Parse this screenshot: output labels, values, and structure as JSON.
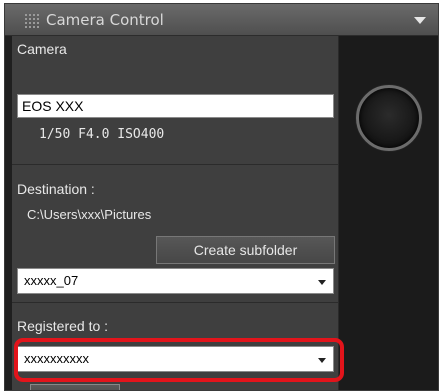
{
  "panel": {
    "title": "Camera Control"
  },
  "camera": {
    "label": "Camera",
    "model": "EOS XXX",
    "settings": "1/50  F4.0  ISO400"
  },
  "destination": {
    "label": "Destination :",
    "path": "C:\\Users\\xxx\\Pictures",
    "create_subfolder_label": "Create subfolder",
    "subfolder_value": "xxxxx_07"
  },
  "registration": {
    "label": "Registered to :",
    "value": "xxxxxxxxxx"
  },
  "colors": {
    "highlight": "#e2141b",
    "panel_bg": "#3f3f3f",
    "title_bg": "#5a5a5a"
  },
  "icons": {
    "grip": "grip-icon",
    "menu": "dropdown-arrow-icon",
    "shutter": "shutter-release-icon"
  }
}
